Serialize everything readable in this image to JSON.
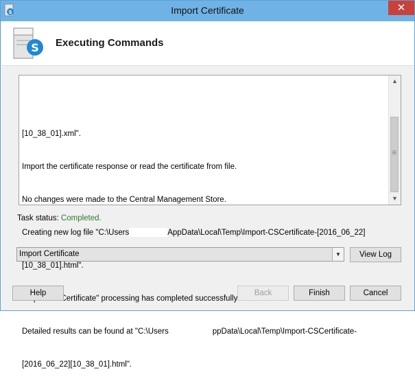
{
  "window": {
    "title": "Import Certificate",
    "close_glyph": "✕"
  },
  "header": {
    "title": "Executing Commands",
    "icon": "skype-server-icon"
  },
  "log": {
    "lines": [
      "[10_38_01].xml\".",
      "Import the certificate response or read the certificate from file.",
      "No changes were made to the Central Management Store.",
      "Creating new log file \"C:\\Users",
      "AppData\\Local\\Temp\\Import-CSCertificate-[2016_06_22]",
      "[10_38_01].html\".",
      "\"Import-CSCertificate\" processing has completed successfully.",
      "Detailed results can be found at \"C:\\Users",
      "ppData\\Local\\Temp\\Import-CSCertificate-",
      "[2016_06_22][10_38_01].html\"."
    ]
  },
  "task_status": {
    "label": "Task status:",
    "value": "Completed."
  },
  "combo": {
    "selected": "Import Certificate"
  },
  "buttons": {
    "view_log": "View Log",
    "help": "Help",
    "back": "Back",
    "finish": "Finish",
    "cancel": "Cancel"
  }
}
